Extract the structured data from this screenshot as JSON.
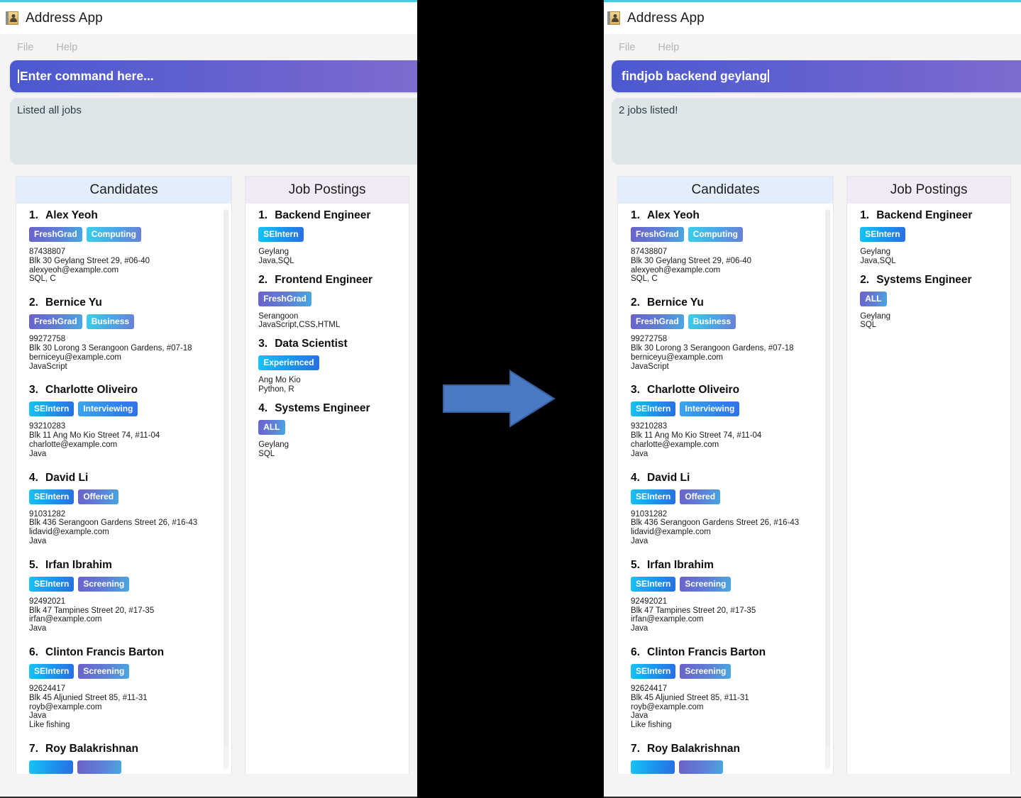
{
  "app": {
    "title": "Address App",
    "icon": "address-book-icon"
  },
  "menu": {
    "file": "File",
    "help": "Help"
  },
  "colors": {
    "accent_border": "#3fd0e0",
    "command_gradient_start": "#4c59cf",
    "command_gradient_end": "#7f6ecf",
    "result_bg": "#dde5e8",
    "candidates_header_bg": "#e2eefb",
    "jobs_header_bg": "#f0eaf6",
    "arrow_fill": "#4a7ac4",
    "arrow_stroke": "#3a5f9e",
    "gap_bg": "#000000"
  },
  "arrow": {
    "name": "right-arrow"
  },
  "before": {
    "command": {
      "value": "Enter command here...",
      "is_placeholder": true
    },
    "result": {
      "text": "Listed all jobs"
    },
    "candidates_panel": {
      "title": "Candidates"
    },
    "jobs_panel": {
      "title": "Job Postings"
    },
    "candidates": [
      {
        "index": "1.",
        "name": "Alex Yeoh",
        "tags": [
          {
            "label": "FreshGrad",
            "style": "t-purple"
          },
          {
            "label": "Computing",
            "style": "t-cyan"
          }
        ],
        "phone": "87438807",
        "address": "Blk 30 Geylang Street 29, #06-40",
        "email": "alexyeoh@example.com",
        "skills": "SQL, C",
        "note": ""
      },
      {
        "index": "2.",
        "name": "Bernice Yu",
        "tags": [
          {
            "label": "FreshGrad",
            "style": "t-purple"
          },
          {
            "label": "Business",
            "style": "t-cyan"
          }
        ],
        "phone": "99272758",
        "address": "Blk 30 Lorong 3 Serangoon Gardens, #07-18",
        "email": "berniceyu@example.com",
        "skills": "JavaScript",
        "note": ""
      },
      {
        "index": "3.",
        "name": "Charlotte Oliveiro",
        "tags": [
          {
            "label": "SEIntern",
            "style": "t-blue"
          },
          {
            "label": "Interviewing",
            "style": "t-lblue"
          }
        ],
        "phone": "93210283",
        "address": "Blk 11 Ang Mo Kio Street 74, #11-04",
        "email": "charlotte@example.com",
        "skills": "Java",
        "note": ""
      },
      {
        "index": "4.",
        "name": "David Li",
        "tags": [
          {
            "label": "SEIntern",
            "style": "t-blue"
          },
          {
            "label": "Offered",
            "style": "t-purple"
          }
        ],
        "phone": "91031282",
        "address": "Blk 436 Serangoon Gardens Street 26, #16-43",
        "email": "lidavid@example.com",
        "skills": "Java",
        "note": ""
      },
      {
        "index": "5.",
        "name": "Irfan Ibrahim",
        "tags": [
          {
            "label": "SEIntern",
            "style": "t-blue"
          },
          {
            "label": "Screening",
            "style": "t-purple"
          }
        ],
        "phone": "92492021",
        "address": "Blk 47 Tampines Street 20, #17-35",
        "email": "irfan@example.com",
        "skills": "Java",
        "note": ""
      },
      {
        "index": "6.",
        "name": "Clinton Francis Barton",
        "tags": [
          {
            "label": "SEIntern",
            "style": "t-blue"
          },
          {
            "label": "Screening",
            "style": "t-purple"
          }
        ],
        "phone": "92624417",
        "address": "Blk 45 Aljunied Street 85, #11-31",
        "email": "royb@example.com",
        "skills": "Java",
        "note": "Like fishing"
      },
      {
        "index": "7.",
        "name": "Roy Balakrishnan",
        "tags": [
          {
            "label": "",
            "style": "t-blue"
          },
          {
            "label": "",
            "style": "t-purple"
          }
        ],
        "phone": "",
        "address": "",
        "email": "",
        "skills": "",
        "note": ""
      }
    ],
    "jobs": [
      {
        "index": "1.",
        "title": "Backend Engineer",
        "tags": [
          {
            "label": "SEIntern",
            "style": "t-blue"
          }
        ],
        "location": "Geylang",
        "skills": "Java,SQL"
      },
      {
        "index": "2.",
        "title": "Frontend Engineer",
        "tags": [
          {
            "label": "FreshGrad",
            "style": "t-purple"
          }
        ],
        "location": "Serangoon",
        "skills": "JavaScript,CSS,HTML"
      },
      {
        "index": "3.",
        "title": "Data Scientist",
        "tags": [
          {
            "label": "Experienced",
            "style": "t-blue"
          }
        ],
        "location": "Ang Mo Kio",
        "skills": "Python, R"
      },
      {
        "index": "4.",
        "title": "Systems Engineer",
        "tags": [
          {
            "label": "ALL",
            "style": "t-purple"
          }
        ],
        "location": "Geylang",
        "skills": "SQL"
      }
    ]
  },
  "after": {
    "command": {
      "value": "findjob backend geylang",
      "is_placeholder": false
    },
    "result": {
      "text": "2 jobs listed!"
    },
    "candidates_panel": {
      "title": "Candidates"
    },
    "jobs_panel": {
      "title": "Job Postings"
    },
    "candidates": [
      {
        "index": "1.",
        "name": "Alex Yeoh",
        "tags": [
          {
            "label": "FreshGrad",
            "style": "t-purple"
          },
          {
            "label": "Computing",
            "style": "t-cyan"
          }
        ],
        "phone": "87438807",
        "address": "Blk 30 Geylang Street 29, #06-40",
        "email": "alexyeoh@example.com",
        "skills": "SQL, C",
        "note": ""
      },
      {
        "index": "2.",
        "name": "Bernice Yu",
        "tags": [
          {
            "label": "FreshGrad",
            "style": "t-purple"
          },
          {
            "label": "Business",
            "style": "t-cyan"
          }
        ],
        "phone": "99272758",
        "address": "Blk 30 Lorong 3 Serangoon Gardens, #07-18",
        "email": "berniceyu@example.com",
        "skills": "JavaScript",
        "note": ""
      },
      {
        "index": "3.",
        "name": "Charlotte Oliveiro",
        "tags": [
          {
            "label": "SEIntern",
            "style": "t-blue"
          },
          {
            "label": "Interviewing",
            "style": "t-lblue"
          }
        ],
        "phone": "93210283",
        "address": "Blk 11 Ang Mo Kio Street 74, #11-04",
        "email": "charlotte@example.com",
        "skills": "Java",
        "note": ""
      },
      {
        "index": "4.",
        "name": "David Li",
        "tags": [
          {
            "label": "SEIntern",
            "style": "t-blue"
          },
          {
            "label": "Offered",
            "style": "t-purple"
          }
        ],
        "phone": "91031282",
        "address": "Blk 436 Serangoon Gardens Street 26, #16-43",
        "email": "lidavid@example.com",
        "skills": "Java",
        "note": ""
      },
      {
        "index": "5.",
        "name": "Irfan Ibrahim",
        "tags": [
          {
            "label": "SEIntern",
            "style": "t-blue"
          },
          {
            "label": "Screening",
            "style": "t-purple"
          }
        ],
        "phone": "92492021",
        "address": "Blk 47 Tampines Street 20, #17-35",
        "email": "irfan@example.com",
        "skills": "Java",
        "note": ""
      },
      {
        "index": "6.",
        "name": "Clinton Francis Barton",
        "tags": [
          {
            "label": "SEIntern",
            "style": "t-blue"
          },
          {
            "label": "Screening",
            "style": "t-purple"
          }
        ],
        "phone": "92624417",
        "address": "Blk 45 Aljunied Street 85, #11-31",
        "email": "royb@example.com",
        "skills": "Java",
        "note": "Like fishing"
      },
      {
        "index": "7.",
        "name": "Roy Balakrishnan",
        "tags": [
          {
            "label": "",
            "style": "t-blue"
          },
          {
            "label": "",
            "style": "t-purple"
          }
        ],
        "phone": "",
        "address": "",
        "email": "",
        "skills": "",
        "note": ""
      }
    ],
    "jobs": [
      {
        "index": "1.",
        "title": "Backend Engineer",
        "tags": [
          {
            "label": "SEIntern",
            "style": "t-blue"
          }
        ],
        "location": "Geylang",
        "skills": "Java,SQL"
      },
      {
        "index": "2.",
        "title": "Systems Engineer",
        "tags": [
          {
            "label": "ALL",
            "style": "t-purple"
          }
        ],
        "location": "Geylang",
        "skills": "SQL"
      }
    ]
  }
}
